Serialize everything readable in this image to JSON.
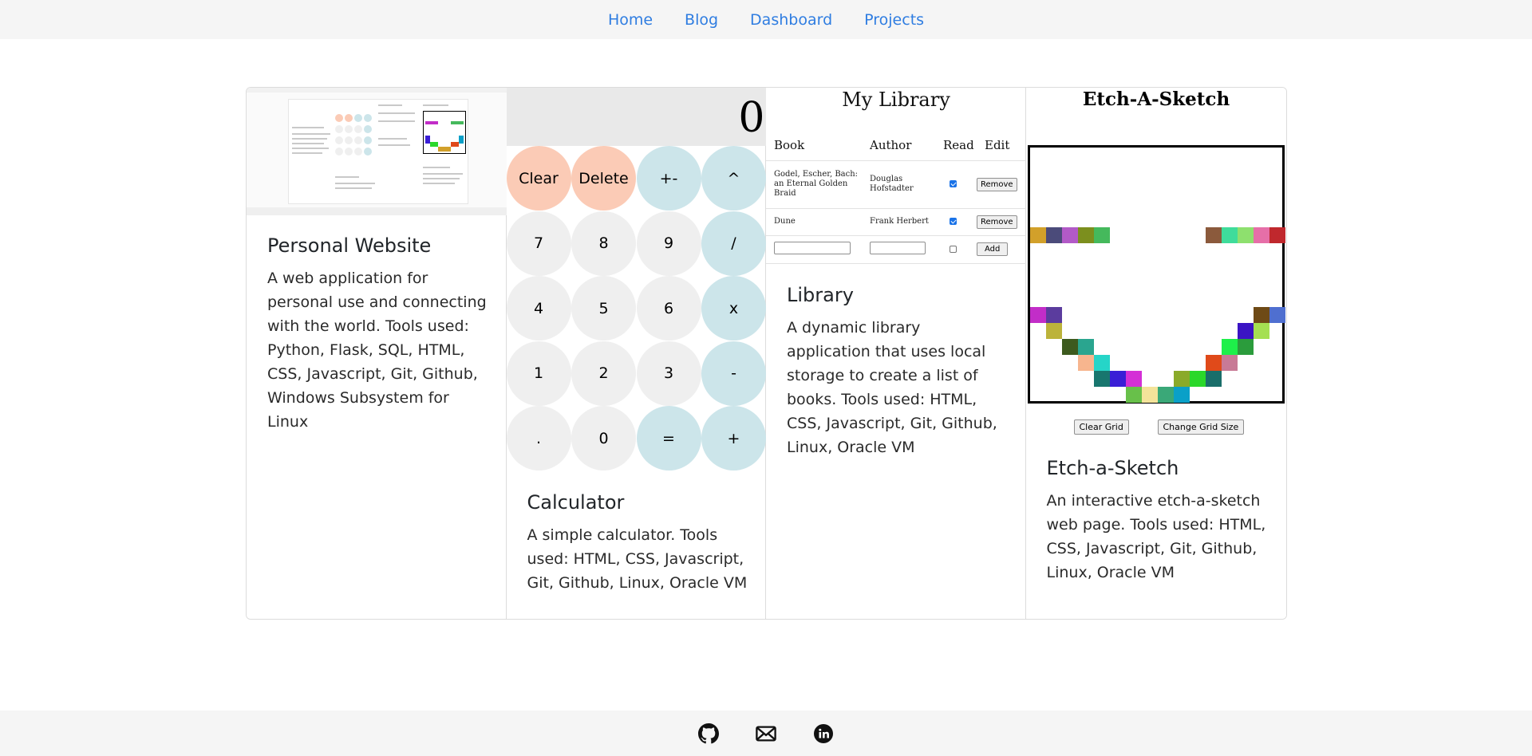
{
  "nav": {
    "items": [
      {
        "label": "Home"
      },
      {
        "label": "Blog"
      },
      {
        "label": "Dashboard"
      },
      {
        "label": "Projects"
      }
    ]
  },
  "cards": [
    {
      "title": "Personal Website",
      "text": "A web application for personal use and connecting with the world. Tools used: Python, Flask, SQL, HTML, CSS, Javascript, Git, Github, Windows Subsystem for Linux"
    },
    {
      "title": "Calculator",
      "text": "A simple calculator. Tools used: HTML, CSS, Javascript, Git, Github, Linux, Oracle VM"
    },
    {
      "title": "Library",
      "text": "A dynamic library application that uses local storage to create a list of books. Tools used: HTML, CSS, Javascript, Git, Github, Linux, Oracle VM"
    },
    {
      "title": "Etch-a-Sketch",
      "text": "An interactive etch-a-sketch web page. Tools used: HTML, CSS, Javascript, Git, Github, Linux, Oracle VM"
    }
  ],
  "calculator": {
    "display": "0",
    "buttons": [
      {
        "label": "Clear",
        "style": "salmon"
      },
      {
        "label": "Delete",
        "style": "salmon"
      },
      {
        "label": "+-",
        "style": "op"
      },
      {
        "label": "^",
        "style": "op"
      },
      {
        "label": "7",
        "style": "num"
      },
      {
        "label": "8",
        "style": "num"
      },
      {
        "label": "9",
        "style": "num"
      },
      {
        "label": "/",
        "style": "op"
      },
      {
        "label": "4",
        "style": "num"
      },
      {
        "label": "5",
        "style": "num"
      },
      {
        "label": "6",
        "style": "num"
      },
      {
        "label": "x",
        "style": "op"
      },
      {
        "label": "1",
        "style": "num"
      },
      {
        "label": "2",
        "style": "num"
      },
      {
        "label": "3",
        "style": "num"
      },
      {
        "label": "-",
        "style": "op"
      },
      {
        "label": ".",
        "style": "num"
      },
      {
        "label": "0",
        "style": "num"
      },
      {
        "label": "=",
        "style": "op"
      },
      {
        "label": "+",
        "style": "op"
      }
    ],
    "colors": {
      "salmon": "#fbcbb6",
      "num": "#efefef",
      "op": "#cce5ea"
    }
  },
  "library": {
    "title": "My Library",
    "headers": {
      "book": "Book",
      "author": "Author",
      "read": "Read",
      "edit": "Edit"
    },
    "rows": [
      {
        "book": "Godel, Escher, Bach: an Eternal Golden Braid",
        "author": "Douglas Hofstadter",
        "read": true,
        "action": "Remove"
      },
      {
        "book": "Dune",
        "author": "Frank Herbert",
        "read": true,
        "action": "Remove"
      }
    ],
    "new_row": {
      "read": false,
      "action": "Add"
    }
  },
  "etch": {
    "title": "Etch-A-Sketch",
    "clear_label": "Clear Grid",
    "resize_label": "Change Grid Size",
    "pixels": [
      {
        "c": 0,
        "r": 5,
        "color": "#d2a02a"
      },
      {
        "c": 1,
        "r": 5,
        "color": "#4b4b7a"
      },
      {
        "c": 2,
        "r": 5,
        "color": "#b25ac7"
      },
      {
        "c": 3,
        "r": 5,
        "color": "#7c8f1e"
      },
      {
        "c": 4,
        "r": 5,
        "color": "#45b95c"
      },
      {
        "c": 11,
        "r": 5,
        "color": "#8b5a3c"
      },
      {
        "c": 12,
        "r": 5,
        "color": "#3fdc9b"
      },
      {
        "c": 13,
        "r": 5,
        "color": "#8ee06e"
      },
      {
        "c": 14,
        "r": 5,
        "color": "#e66fa8"
      },
      {
        "c": 15,
        "r": 5,
        "color": "#c0282d"
      },
      {
        "c": 0,
        "r": 10,
        "color": "#c22dc8"
      },
      {
        "c": 1,
        "r": 10,
        "color": "#5b3c9e"
      },
      {
        "c": 14,
        "r": 10,
        "color": "#6e4a16"
      },
      {
        "c": 15,
        "r": 10,
        "color": "#4f6fd0"
      },
      {
        "c": 1,
        "r": 11,
        "color": "#bcb33a"
      },
      {
        "c": 13,
        "r": 11,
        "color": "#3b14c4"
      },
      {
        "c": 14,
        "r": 11,
        "color": "#a5e052"
      },
      {
        "c": 2,
        "r": 12,
        "color": "#3d5a1e"
      },
      {
        "c": 3,
        "r": 12,
        "color": "#2aa58f"
      },
      {
        "c": 12,
        "r": 12,
        "color": "#1ef04a"
      },
      {
        "c": 13,
        "r": 12,
        "color": "#2b9c3c"
      },
      {
        "c": 3,
        "r": 13,
        "color": "#f7b58e"
      },
      {
        "c": 4,
        "r": 13,
        "color": "#26d5c8"
      },
      {
        "c": 11,
        "r": 13,
        "color": "#e04a1a"
      },
      {
        "c": 12,
        "r": 13,
        "color": "#c87a96"
      },
      {
        "c": 4,
        "r": 14,
        "color": "#18766e"
      },
      {
        "c": 5,
        "r": 14,
        "color": "#3a1ed6"
      },
      {
        "c": 6,
        "r": 14,
        "color": "#d42fd6"
      },
      {
        "c": 9,
        "r": 14,
        "color": "#8aaa2a"
      },
      {
        "c": 10,
        "r": 14,
        "color": "#2ad82a"
      },
      {
        "c": 11,
        "r": 14,
        "color": "#1a6e6a"
      },
      {
        "c": 6,
        "r": 15,
        "color": "#68c04a"
      },
      {
        "c": 7,
        "r": 15,
        "color": "#f3e39a"
      },
      {
        "c": 8,
        "r": 15,
        "color": "#3aa878"
      },
      {
        "c": 9,
        "r": 15,
        "color": "#0aa0c8"
      }
    ]
  },
  "footer": {
    "icons": [
      "github-icon",
      "mail-icon",
      "linkedin-icon"
    ]
  }
}
